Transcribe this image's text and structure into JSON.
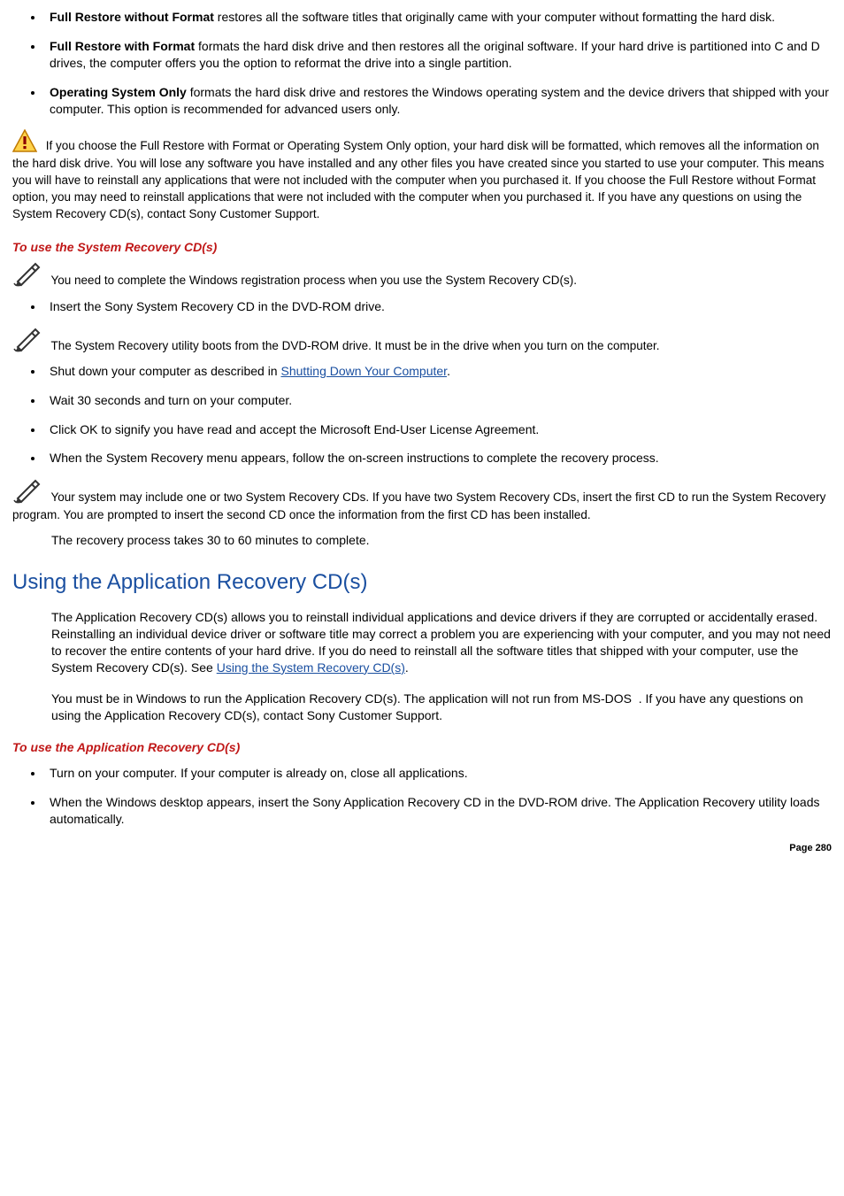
{
  "options": [
    {
      "title": "Full Restore without Format",
      "desc": " restores all the software titles that originally came with your computer without formatting the hard disk."
    },
    {
      "title": "Full Restore with Format",
      "desc": " formats the hard disk drive and then restores all the original software. If your hard drive is partitioned into C and D drives, the computer offers you the option to reformat the drive into a single partition."
    },
    {
      "title": "Operating System Only",
      "desc": " formats the hard disk drive and restores the Windows operating system and the device drivers that shipped with your computer. This option is recommended for advanced users only."
    }
  ],
  "warning_text": " If you choose the Full Restore with Format or Operating System Only option, your hard disk will be formatted, which removes all the information on the hard disk drive. You will lose any software you have installed and any other files you have created since you started to use your computer. This means you will have to reinstall any applications that were not included with the computer when you purchased it. If you choose the Full Restore without Format option, you may need to reinstall applications that were not included with the computer when you purchased it. If you have any questions on using the System Recovery CD(s), contact Sony Customer Support.",
  "section1_title": "To use the System Recovery CD(s)",
  "note1": " You need to complete the Windows registration process when you use the System Recovery CD(s).",
  "step1": "Insert the Sony System Recovery CD in the DVD-ROM drive.",
  "note2": " The System Recovery utility boots from the DVD-ROM drive. It must be in the drive when you turn on the computer.",
  "steps_mid": {
    "a_prefix": "Shut down your computer as described in ",
    "a_link": "Shutting Down Your Computer",
    "a_suffix": ".",
    "b": "Wait 30 seconds and turn on your computer.",
    "c": "Click OK to signify you have read and accept the Microsoft End-User License Agreement.",
    "d": "When the System Recovery menu appears, follow the on-screen instructions to complete the recovery process."
  },
  "note3": " Your system may include one or two System Recovery CDs. If you have two System Recovery CDs, insert the first CD to run the System Recovery program. You are prompted to insert the second CD once the information from the first CD has been installed.",
  "recovery_time": "The recovery process takes 30 to 60 minutes to complete.",
  "heading_app": "Using the Application Recovery CD(s)",
  "app_para1_prefix": "The Application Recovery CD(s) allows you to reinstall individual applications and device drivers if they are corrupted or accidentally erased. Reinstalling an individual device driver or software title may correct a problem you are experiencing with your computer, and you may not need to recover the entire contents of your hard drive. If you do need to reinstall all the software titles that shipped with your computer, use the System Recovery CD(s). See ",
  "app_para1_link": "Using the System Recovery CD(s)",
  "app_para1_suffix": ".",
  "app_para2": "You must be in Windows to run the Application Recovery CD(s). The application will not run from MS-DOS  . If you have any questions on using the Application Recovery CD(s), contact Sony Customer Support.",
  "section2_title": "To use the Application Recovery CD(s)",
  "app_steps": {
    "a": "Turn on your computer. If your computer is already on, close all applications.",
    "b": "When the Windows desktop appears, insert the Sony Application Recovery CD in the DVD-ROM drive. The Application Recovery utility loads automatically."
  },
  "page_label": "Page 280"
}
